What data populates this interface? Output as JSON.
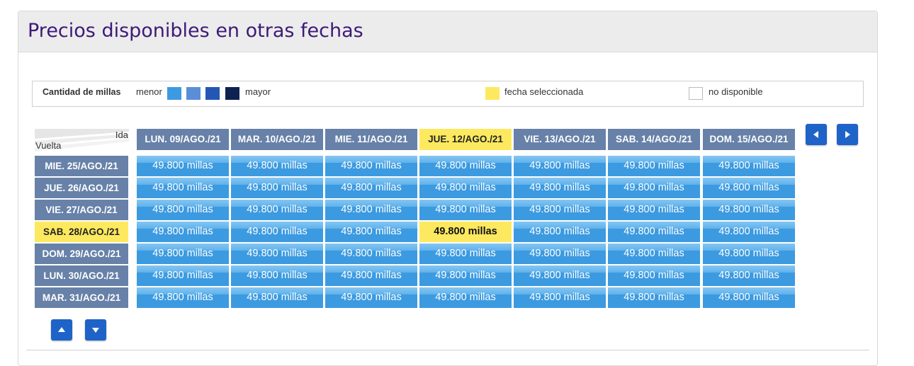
{
  "header": {
    "title": "Precios disponibles en otras fechas"
  },
  "legend": {
    "title": "Cantidad de millas",
    "less": "menor",
    "more": "mayor",
    "scale_colors": [
      "#3c9ae0",
      "#5a8fd8",
      "#2457b5",
      "#0d2250"
    ],
    "selected_label": "fecha seleccionada",
    "selected_color": "#fde95f",
    "unavailable_label": "no disponible"
  },
  "grid": {
    "outbound_label": "Ida",
    "return_label": "Vuelta",
    "outbound_dates": [
      "LUN. 09/AGO./21",
      "MAR. 10/AGO./21",
      "MIE. 11/AGO./21",
      "JUE. 12/AGO./21",
      "VIE. 13/AGO./21",
      "SAB. 14/AGO./21",
      "DOM. 15/AGO./21"
    ],
    "return_dates": [
      "MIE. 25/AGO./21",
      "JUE. 26/AGO./21",
      "VIE. 27/AGO./21",
      "SAB. 28/AGO./21",
      "DOM. 29/AGO./21",
      "LUN. 30/AGO./21",
      "MAR. 31/AGO./21"
    ],
    "selected_outbound": "JUE. 12/AGO./21",
    "selected_return": "SAB. 28/AGO./21",
    "prices": [
      [
        "49.800 millas",
        "49.800 millas",
        "49.800 millas",
        "49.800 millas",
        "49.800 millas",
        "49.800 millas",
        "49.800 millas"
      ],
      [
        "49.800 millas",
        "49.800 millas",
        "49.800 millas",
        "49.800 millas",
        "49.800 millas",
        "49.800 millas",
        "49.800 millas"
      ],
      [
        "49.800 millas",
        "49.800 millas",
        "49.800 millas",
        "49.800 millas",
        "49.800 millas",
        "49.800 millas",
        "49.800 millas"
      ],
      [
        "49.800 millas",
        "49.800 millas",
        "49.800 millas",
        "49.800 millas",
        "49.800 millas",
        "49.800 millas",
        "49.800 millas"
      ],
      [
        "49.800 millas",
        "49.800 millas",
        "49.800 millas",
        "49.800 millas",
        "49.800 millas",
        "49.800 millas",
        "49.800 millas"
      ],
      [
        "49.800 millas",
        "49.800 millas",
        "49.800 millas",
        "49.800 millas",
        "49.800 millas",
        "49.800 millas",
        "49.800 millas"
      ],
      [
        "49.800 millas",
        "49.800 millas",
        "49.800 millas",
        "49.800 millas",
        "49.800 millas",
        "49.800 millas",
        "49.800 millas"
      ]
    ]
  },
  "nav": {
    "prev_icon": "caret-left-icon",
    "next_icon": "caret-right-icon",
    "up_icon": "caret-up-icon",
    "down_icon": "caret-down-icon"
  }
}
